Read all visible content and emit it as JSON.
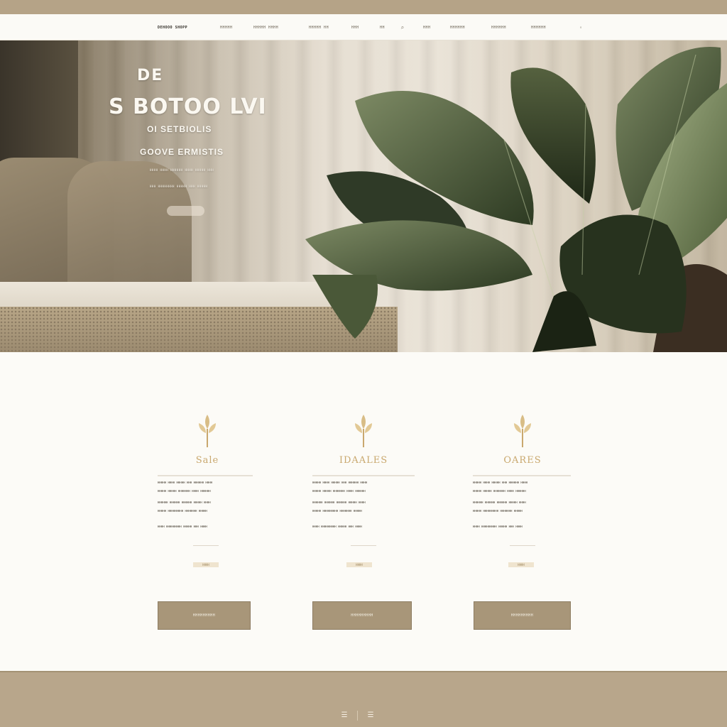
{
  "nav": {
    "brand": "DEHOOO SHOPP",
    "items": [
      "HHHHH",
      "HHHHH HHHH",
      "HHHHH HH",
      "HHH",
      "HH",
      "HHH",
      "HHHHHH",
      "HHHHHH",
      "HHHHHH"
    ],
    "icons": [
      "search-icon"
    ]
  },
  "hero": {
    "line1": "DE",
    "title": "S BOTOO LVI",
    "subtitle": "OI SETBIOLIS",
    "tagline": "GOOVE ERMISTIS",
    "small_lines": [
      "HHHH HHHH HHHHHH HHHH HHHHH HHH",
      "HHH HHHHHHHH HHHHH HHH HHHHH"
    ]
  },
  "cards": [
    {
      "name": "Sale",
      "lines": [
        "HHHHH HHHH HHHHH HHH HHHHHH HHHH",
        "HHHHH HHHHH HHHHHHH HHHH HHHHHH",
        "HHHHHH HHHHHH HHHHHH HHHHH HHHH",
        "HHHHH HHHHHHHHH HHHHHHH HHHHH",
        "HHHH HHHHHHHHH HHHHH HHH HHHH"
      ],
      "tag": "HHHH",
      "button": "HHHHHHHHH"
    },
    {
      "name": "IDAALES",
      "lines": [
        "HHHHH HHHH HHHHH HHH HHHHHH HHHH",
        "HHHHH HHHHH HHHHHHH HHHH HHHHHH",
        "HHHHHH HHHHHH HHHHHH HHHHH HHHH",
        "HHHHH HHHHHHHHH HHHHHHH HHHHH",
        "HHHH HHHHHHHHH HHHHH HHH HHHH"
      ],
      "tag": "HHHH",
      "button": "HHHHHHHHH"
    },
    {
      "name": "OARES",
      "lines": [
        "HHHHH HHHH HHHHH HHH HHHHHH HHHH",
        "HHHHH HHHHH HHHHHHH HHHH HHHHHH",
        "HHHHHH HHHHHH HHHHHH HHHHH HHHH",
        "HHHHH HHHHHHHHH HHHHHHH HHHHH",
        "HHHH HHHHHHHHH HHHHH HHH HHHH"
      ],
      "tag": "HHHH",
      "button": "HHHHHHHHH"
    }
  ],
  "footer": {
    "icons": [
      "menu-icon",
      "list-icon"
    ]
  },
  "colors": {
    "accent": "#a89679",
    "background": "#fcfbf7",
    "gold": "#c9a86e",
    "footer": "#b8a68b"
  }
}
